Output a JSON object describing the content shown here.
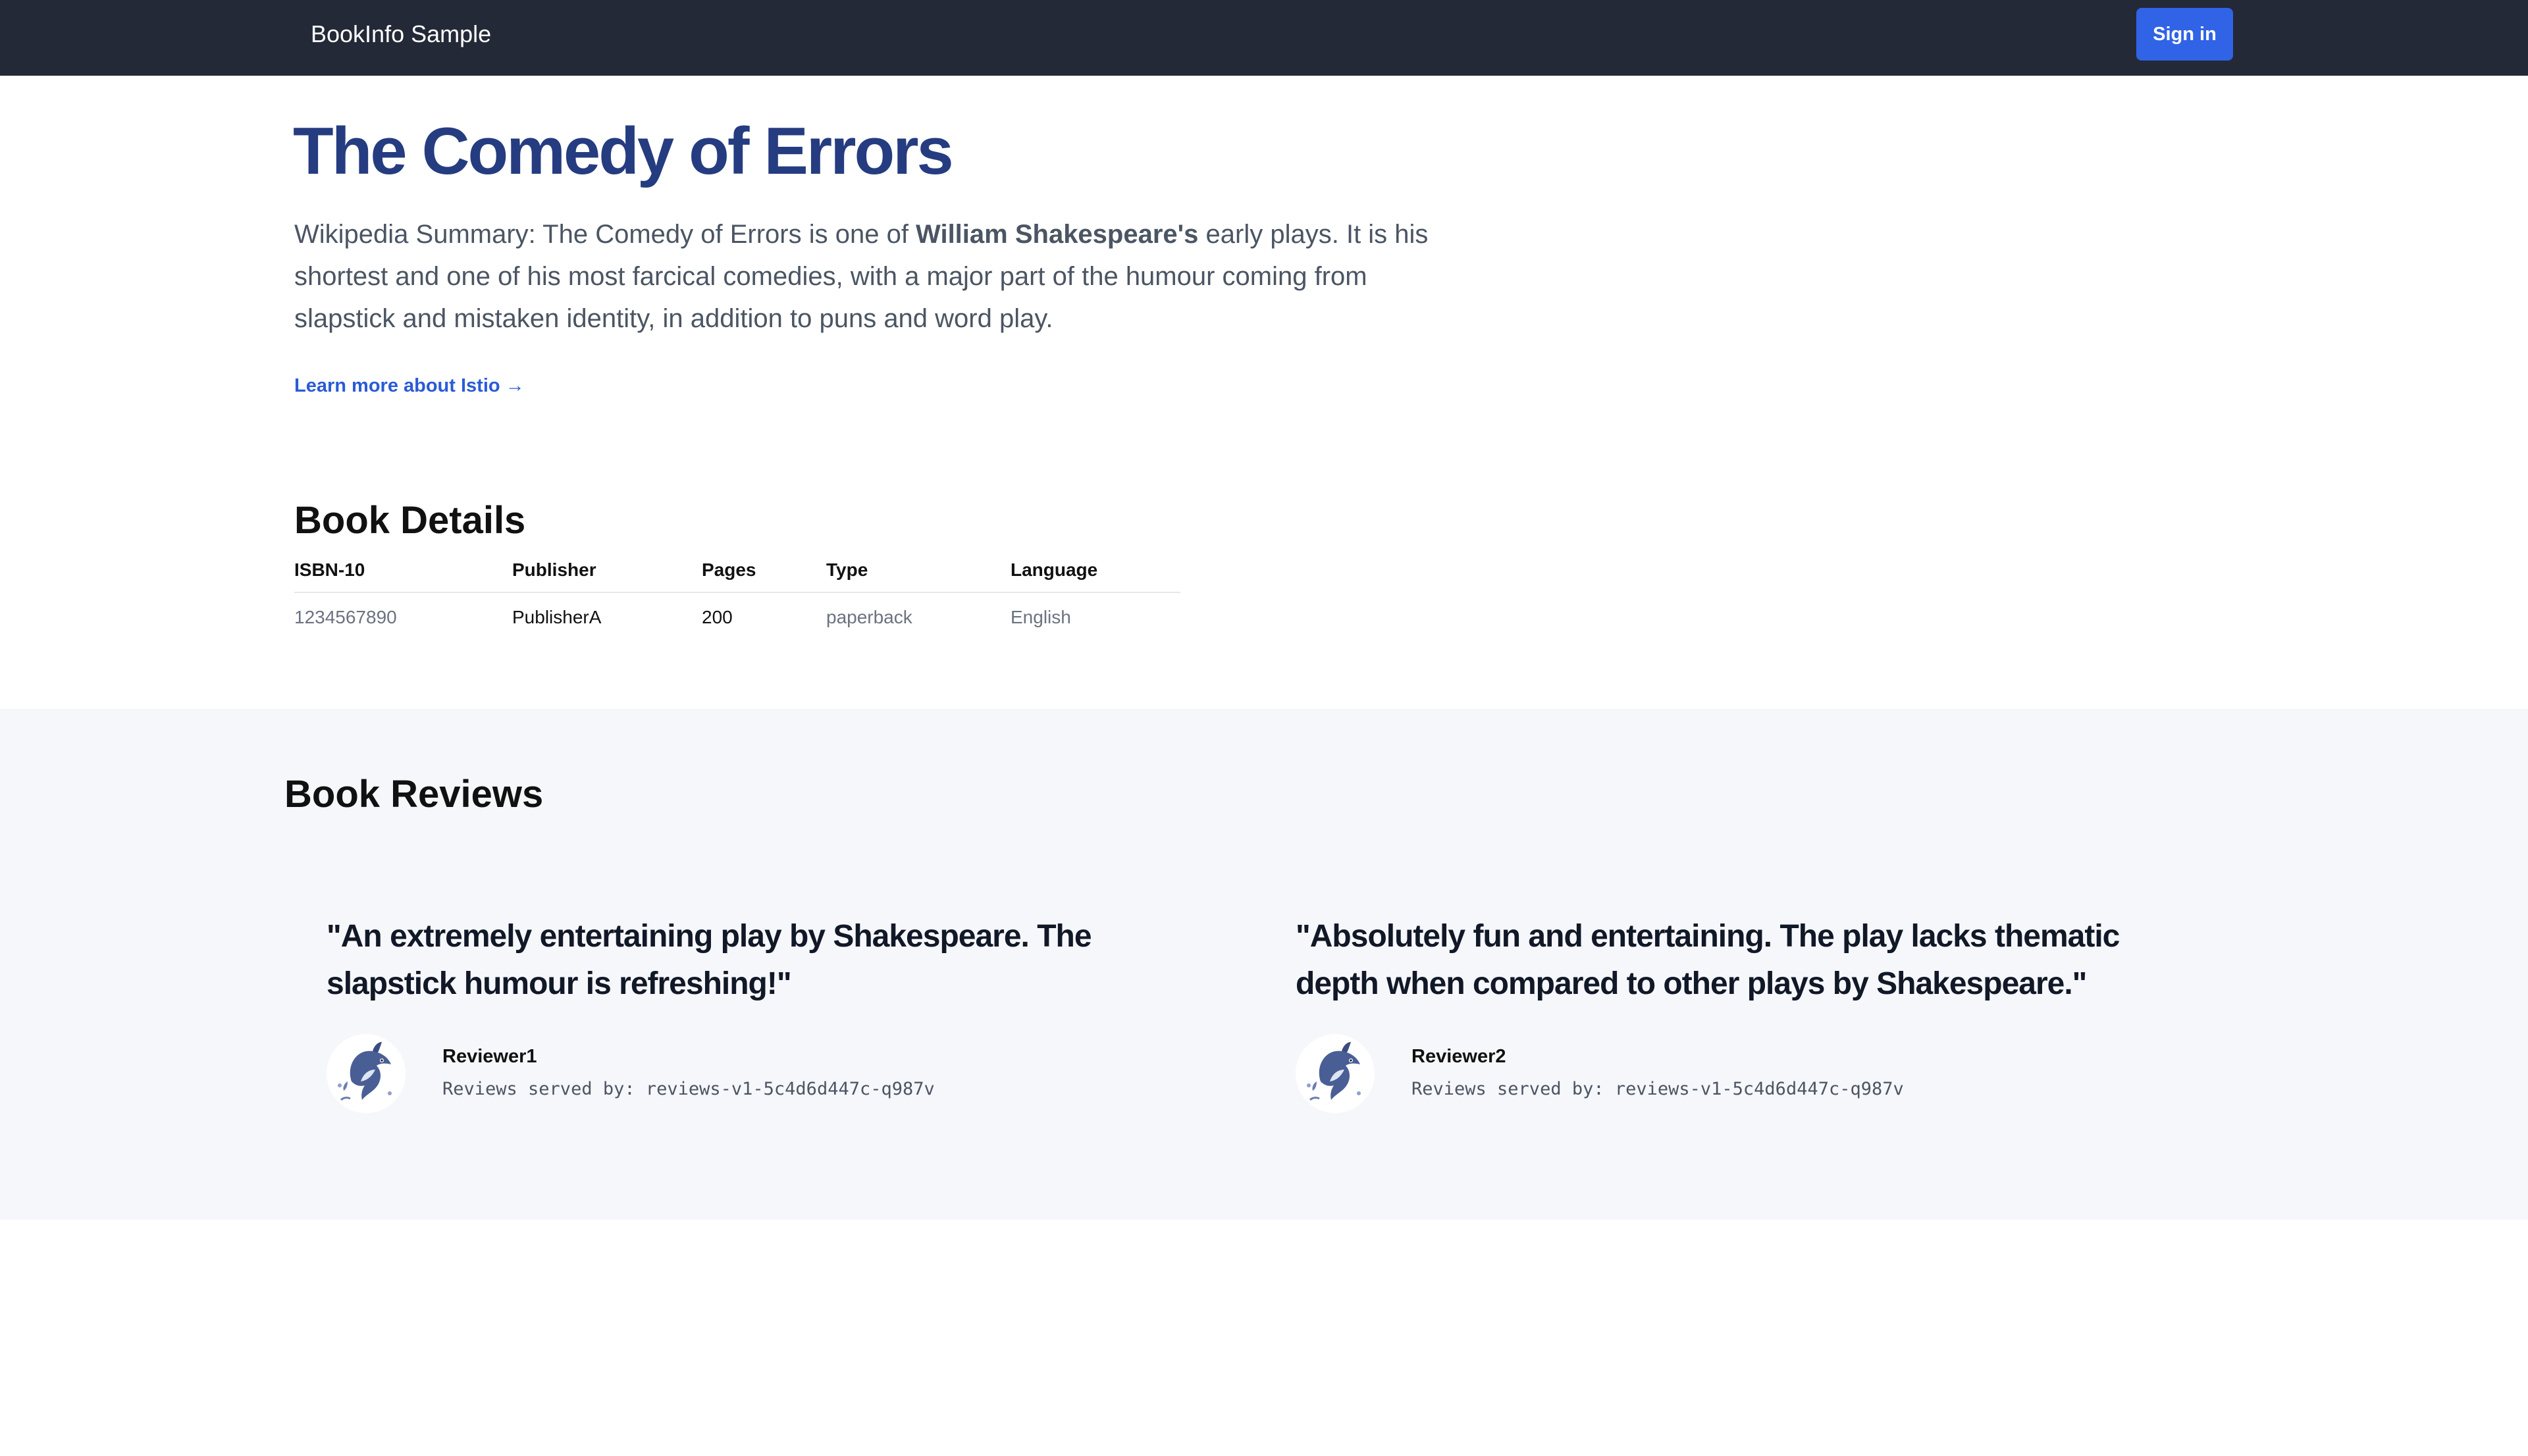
{
  "navbar": {
    "brand": "BookInfo Sample",
    "signin_label": "Sign in"
  },
  "book": {
    "title": "The Comedy of Errors",
    "summary_prefix": "Wikipedia Summary: The Comedy of Errors is one of ",
    "summary_bold": "William Shakespeare's",
    "summary_suffix": " early plays. It is his shortest and one of his most farcical comedies, with a major part of the humour coming from slapstick and mistaken identity, in addition to puns and word play.",
    "learn_more": "Learn more about Istio →"
  },
  "details": {
    "heading": "Book Details",
    "headers": {
      "isbn": "ISBN-10",
      "publisher": "Publisher",
      "pages": "Pages",
      "type": "Type",
      "language": "Language"
    },
    "row": {
      "isbn": "1234567890",
      "publisher": "PublisherA",
      "pages": "200",
      "type": "paperback",
      "language": "English"
    }
  },
  "reviews": {
    "heading": "Book Reviews",
    "items": [
      {
        "quote": "\"An extremely entertaining play by Shakespeare. The slapstick humour is refreshing!\"",
        "reviewer": "Reviewer1",
        "served_by": "Reviews served by: reviews-v1-5c4d6d447c-q987v",
        "avatar_icon": "dolphin-avatar-icon"
      },
      {
        "quote": "\"Absolutely fun and entertaining. The play lacks thematic depth when compared to other plays by Shakespeare.\"",
        "reviewer": "Reviewer2",
        "served_by": "Reviews served by: reviews-v1-5c4d6d447c-q987v",
        "avatar_icon": "dolphin-avatar-icon"
      }
    ]
  },
  "colors": {
    "navbar_bg": "#242937",
    "signin_bg": "#3063e6",
    "title": "#253c80",
    "link": "#2a5bd7",
    "reviews_bg": "#f6f7fb"
  }
}
